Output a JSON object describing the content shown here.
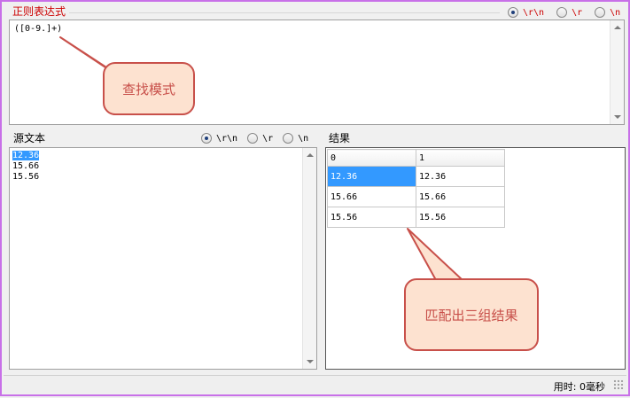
{
  "regex_panel": {
    "title": "正则表达式",
    "pattern": "([0-9.]+)",
    "newline_options": [
      {
        "label": "\\r\\n",
        "checked": true
      },
      {
        "label": "\\r",
        "checked": false
      },
      {
        "label": "\\n",
        "checked": false
      }
    ],
    "accent_color": "#cc0000"
  },
  "source_panel": {
    "title": "源文本",
    "lines": [
      "12.36",
      "15.66",
      "15.56"
    ],
    "selected_line": "12.36",
    "newline_options": [
      {
        "label": "\\r\\n",
        "checked": true
      },
      {
        "label": "\\r",
        "checked": false
      },
      {
        "label": "\\n",
        "checked": false
      }
    ]
  },
  "result_panel": {
    "title": "结果",
    "columns": [
      "0",
      "1"
    ],
    "rows": [
      [
        "12.36",
        "12.36"
      ],
      [
        "15.66",
        "15.66"
      ],
      [
        "15.56",
        "15.56"
      ]
    ]
  },
  "callouts": {
    "pattern_note": "查找模式",
    "result_note": "匹配出三组结果",
    "color": "#c8504a",
    "fill": "#fde2d0"
  },
  "status_bar": {
    "elapsed": "用时: 0毫秒"
  }
}
